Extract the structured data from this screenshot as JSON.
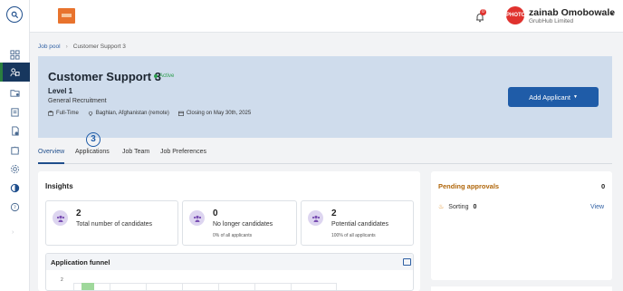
{
  "topbar": {
    "user_name": "zainab Omobowale",
    "user_company": "GrubHub Limited",
    "avatar_text": "PHOTO",
    "notification_count": "0"
  },
  "breadcrumb": {
    "parent": "Job pool",
    "current": "Customer Support 3"
  },
  "job": {
    "title": "Customer Support 3",
    "status": "Active",
    "level": "Level 1",
    "department": "General Recruitment",
    "employment_type": "Full-Time",
    "location": "Baghlan, Afghanistan (remote)",
    "closing": "Closing on May 30th, 2025",
    "add_button": "Add Applicant"
  },
  "tabs": [
    {
      "label": "Overview"
    },
    {
      "label": "Applications"
    },
    {
      "label": "Job Team"
    },
    {
      "label": "Job Preferences"
    }
  ],
  "applications_badge": "3",
  "insights": {
    "title": "Insights",
    "stats": [
      {
        "value": "2",
        "label": "Total number of candidates",
        "sub": ""
      },
      {
        "value": "0",
        "label": "No longer candidates",
        "sub": "0% of all applicants"
      },
      {
        "value": "2",
        "label": "Potential candidates",
        "sub": "100% of all applicants"
      }
    ],
    "funnel_title": "Application funnel",
    "funnel_y_tick": "2"
  },
  "pending": {
    "title": "Pending approvals",
    "count": "0",
    "row_label": "Sorting",
    "row_count": "0",
    "view": "View"
  },
  "colors": {
    "accent": "#1f5ca8",
    "sidebar_active": "#17375e",
    "header_bg": "#cfdcec",
    "active_status": "#2a9d4b",
    "pending_title": "#b0660a"
  }
}
